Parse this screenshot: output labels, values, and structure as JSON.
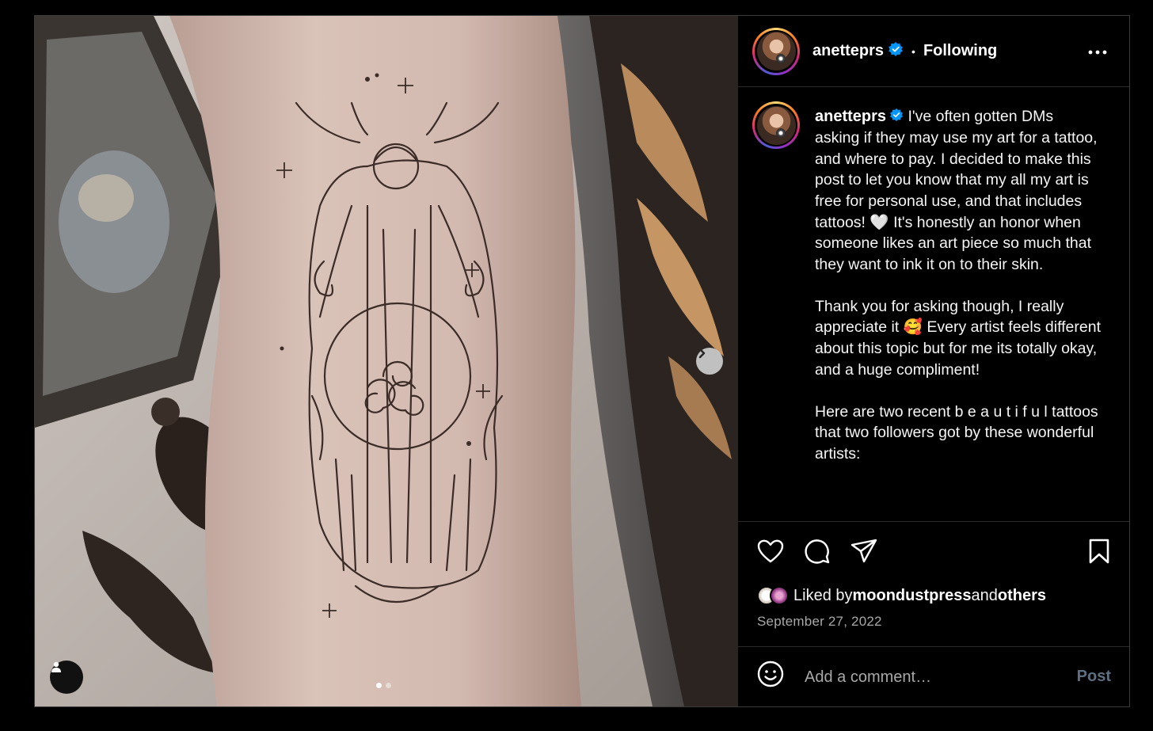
{
  "post": {
    "username": "anetteprs",
    "follow_status": "Following",
    "separator": "•",
    "caption_username": "anetteprs",
    "caption": " I've often gotten DMs asking if they may use my art for a tattoo, and where to pay. I decided to make this post to let you know that my all my art is free for personal use, and that includes tattoos! 🤍 It's honestly an honor when someone likes an art piece so much that they want to ink it on to their skin.\n\nThank you for asking though, I really appreciate it 🥰 Every artist feels different about this topic but for me its totally okay, and a huge compliment!\n\nHere are two recent b e a u t i f u l tattoos that two followers got by these wonderful artists:",
    "liked_by_prefix": "Liked by ",
    "liked_by_user": "moondustpress",
    "liked_by_and": " and ",
    "liked_by_others": "others",
    "date": "September 27, 2022"
  },
  "carousel": {
    "current": 1,
    "total": 2
  },
  "comment": {
    "placeholder": "Add a comment…",
    "post_label": "Post"
  },
  "icons": {
    "more": "more-options-icon",
    "like": "heart-icon",
    "comment": "comment-icon",
    "share": "send-icon",
    "save": "bookmark-icon",
    "emoji": "emoji-icon",
    "next": "chevron-right-icon",
    "tag": "user-tag-icon",
    "verified": "verified-badge-icon"
  },
  "colors": {
    "verified": "#0095f6",
    "post_disabled": "#5d6f80"
  }
}
